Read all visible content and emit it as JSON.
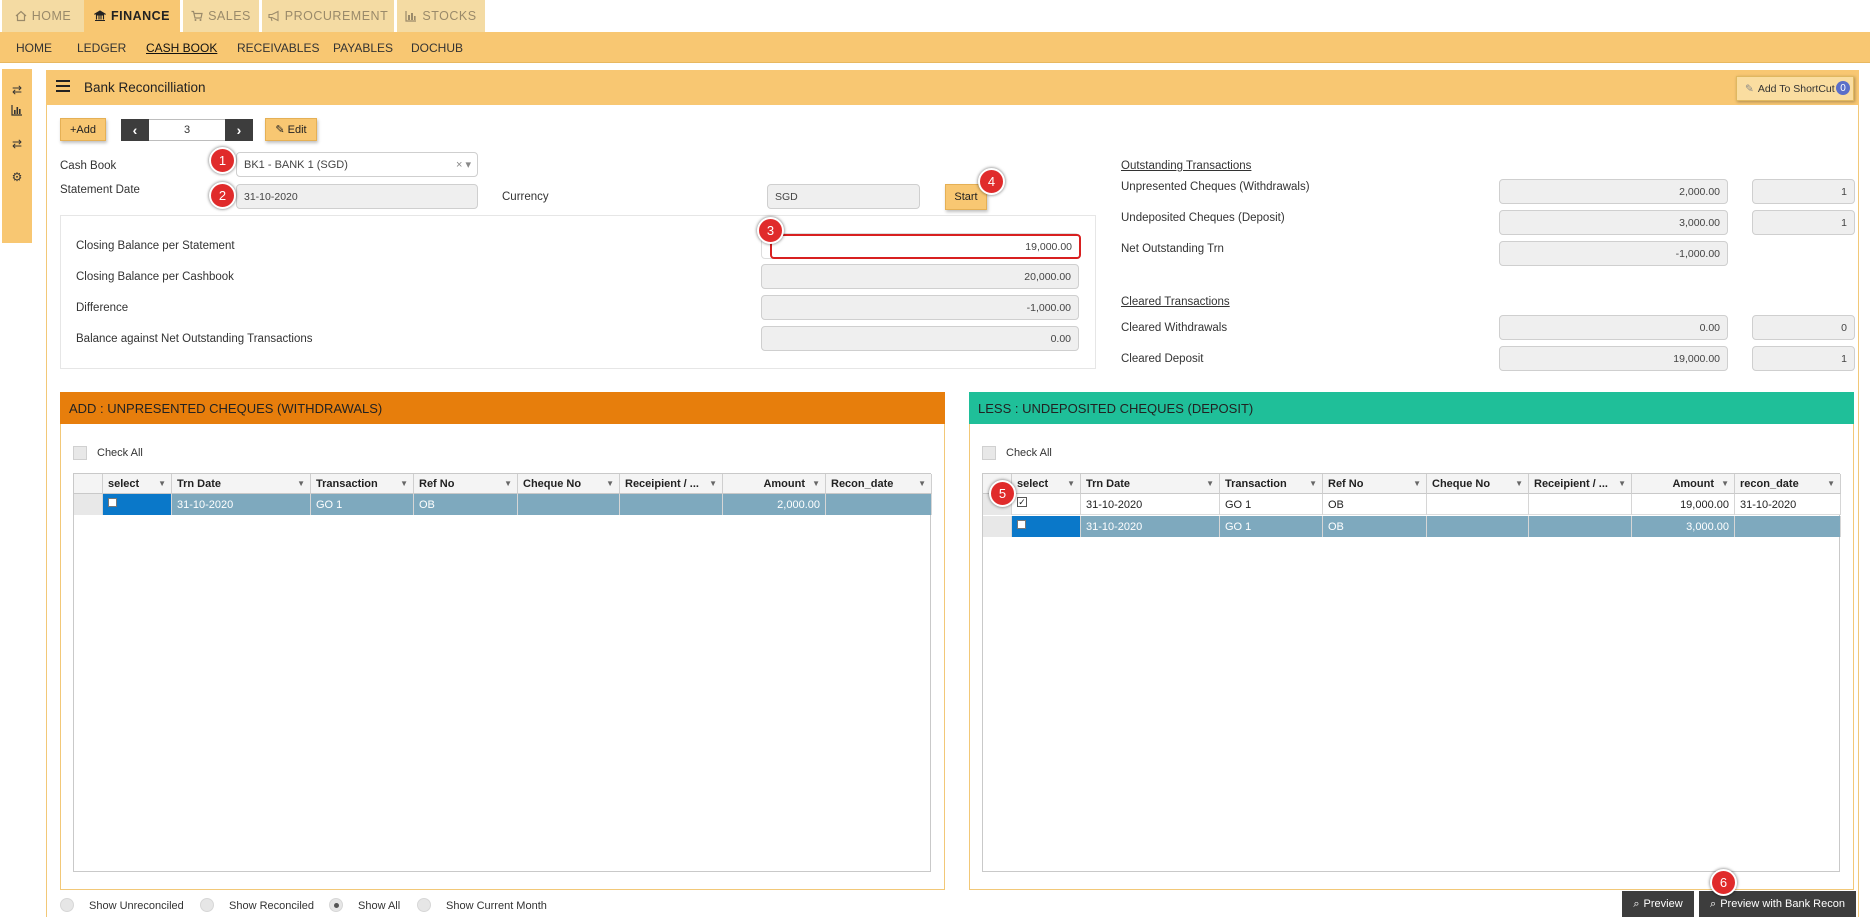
{
  "top_tabs": [
    {
      "label": "HOME",
      "icon": "home-icon"
    },
    {
      "label": "FINANCE",
      "icon": "bank-icon"
    },
    {
      "label": "SALES",
      "icon": "cart-icon"
    },
    {
      "label": "PROCUREMENT",
      "icon": "megaphone-icon"
    },
    {
      "label": "STOCKS",
      "icon": "bar-chart-icon"
    }
  ],
  "sub_nav": [
    "HOME",
    "LEDGER",
    "CASH BOOK",
    "RECEIVABLES",
    "PAYABLES",
    "DOCHUB"
  ],
  "page": {
    "title": "Bank Reconcilliation",
    "shortcut_label": "Add To ShortCut",
    "shortcut_count": "0"
  },
  "toolbar": {
    "add_label": "+Add",
    "record_no": "3",
    "edit_label": "Edit"
  },
  "form": {
    "cash_book_label": "Cash Book",
    "cash_book_value": "BK1 - BANK 1 (SGD)",
    "statement_date_label": "Statement Date",
    "statement_date_value": "31-10-2020",
    "currency_label": "Currency",
    "currency_value": "SGD",
    "start_label": "Start"
  },
  "balances": [
    {
      "label": "Closing Balance per Statement",
      "value": "19,000.00"
    },
    {
      "label": "Closing Balance per Cashbook",
      "value": "20,000.00"
    },
    {
      "label": "Difference",
      "value": "-1,000.00"
    },
    {
      "label": "Balance against Net Outstanding Transactions",
      "value": "0.00"
    }
  ],
  "outstanding": {
    "title": "Outstanding Transactions",
    "rows": [
      {
        "label": "Unpresented Cheques (Withdrawals)",
        "amount": "2,000.00",
        "count": "1"
      },
      {
        "label": "Undeposited Cheques (Deposit)",
        "amount": "3,000.00",
        "count": "1"
      },
      {
        "label": "Net Outstanding Trn",
        "amount": "-1,000.00",
        "count": ""
      }
    ]
  },
  "cleared": {
    "title": "Cleared Transactions",
    "rows": [
      {
        "label": "Cleared Withdrawals",
        "amount": "0.00",
        "count": "0"
      },
      {
        "label": "Cleared Deposit",
        "amount": "19,000.00",
        "count": "1"
      }
    ]
  },
  "withdrawals": {
    "title": "ADD : UNPRESENTED CHEQUES (WITHDRAWALS)",
    "check_all": "Check All",
    "columns": [
      "select",
      "Trn Date",
      "Transaction",
      "Ref No",
      "Cheque No",
      "Receipient / ...",
      "Amount",
      "Recon_date"
    ],
    "rows": [
      {
        "checked": false,
        "cells": [
          "31-10-2020",
          "GO 1",
          "OB",
          "",
          "",
          "2,000.00",
          ""
        ]
      }
    ]
  },
  "deposits": {
    "title": "LESS : UNDEPOSITED CHEQUES (DEPOSIT)",
    "check_all": "Check All",
    "columns": [
      "select",
      "Trn Date",
      "Transaction",
      "Ref No",
      "Cheque No",
      "Receipient / ...",
      "Amount",
      "recon_date"
    ],
    "rows": [
      {
        "checked": true,
        "cells": [
          "31-10-2020",
          "GO 1",
          "OB",
          "",
          "",
          "19,000.00",
          "31-10-2020"
        ]
      },
      {
        "checked": false,
        "cells": [
          "31-10-2020",
          "GO 1",
          "OB",
          "",
          "",
          "3,000.00",
          ""
        ]
      }
    ]
  },
  "filters": {
    "options": [
      "Show Unreconciled",
      "Show Reconciled",
      "Show All",
      "Show Current Month"
    ],
    "selected": "Show All"
  },
  "footer": {
    "preview_label": "Preview",
    "preview_recon_label": "Preview with Bank Recon"
  },
  "markers": [
    "1",
    "2",
    "3",
    "4",
    "5",
    "6"
  ],
  "colors": {
    "accent": "#f8c772",
    "withdrawals_header": "#e77e0c",
    "deposits_header": "#1fbf99",
    "selected_row": "#7ea9be",
    "marker": "#e02b2b"
  }
}
